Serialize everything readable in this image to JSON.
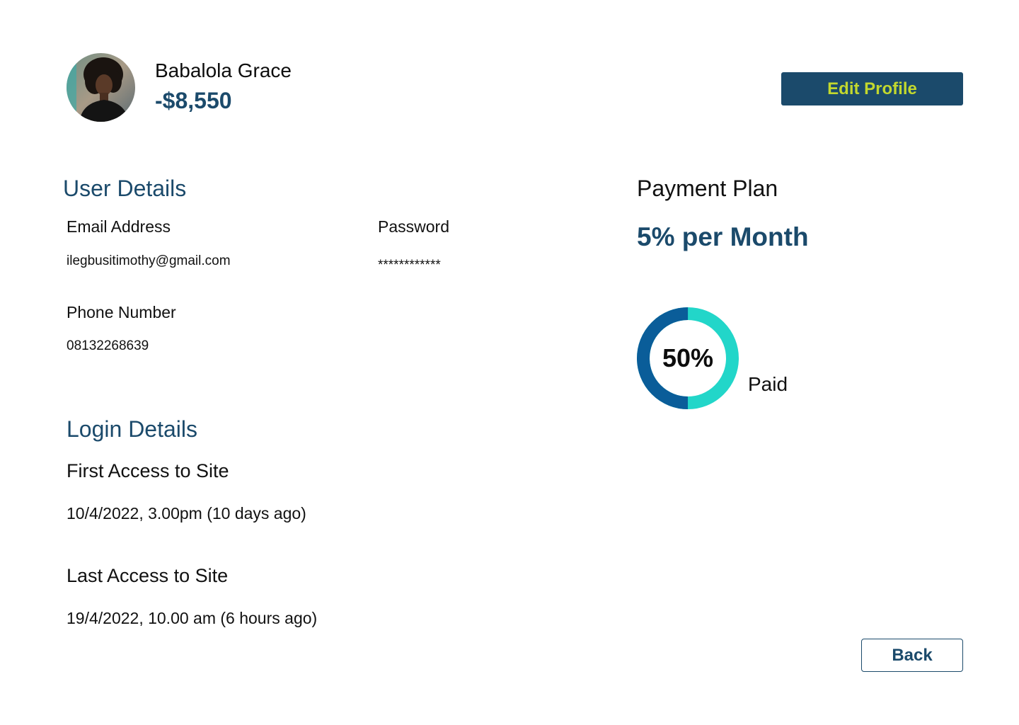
{
  "colors": {
    "primary": "#1b4a6b",
    "accent_text": "#c3d82e",
    "donut_paid": "#0a5d99",
    "donut_remaining": "#22d6c9"
  },
  "profile": {
    "name": "Babalola Grace",
    "balance": "-$8,550",
    "edit_label": "Edit Profile",
    "avatar_icon": "user-avatar-photo"
  },
  "user_details": {
    "title": "User Details",
    "email_label": "Email Address",
    "email_value": "ilegbusitimothy@gmail.com",
    "password_label": "Password",
    "password_value": "************",
    "phone_label": "Phone Number",
    "phone_value": "08132268639"
  },
  "login_details": {
    "title": "Login Details",
    "first_label": "First Access to Site",
    "first_value": "10/4/2022, 3.00pm (10 days ago)",
    "last_label": "Last Access to Site",
    "last_value": "19/4/2022, 10.00 am (6 hours ago)"
  },
  "payment_plan": {
    "title": "Payment Plan",
    "rate": "5% per Month",
    "paid_percent": 50,
    "paid_percent_label": "50%",
    "paid_label": "Paid"
  },
  "actions": {
    "back_label": "Back"
  }
}
